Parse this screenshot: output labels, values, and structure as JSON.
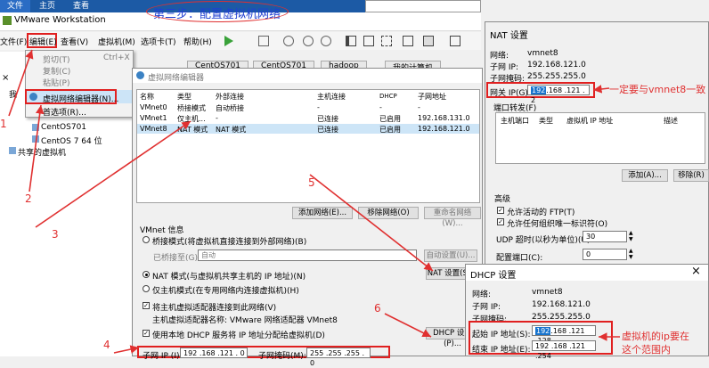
{
  "app": {
    "title": "VMware Workstation",
    "file_tab": "文件",
    "home_tab": "主页",
    "view_tab": "查看"
  },
  "step_title": "第三步：配置虚拟机网络",
  "menubar": {
    "file": "文件(F)",
    "edit": "编辑(E)",
    "view": "查看(V)",
    "vm": "虚拟机(M)",
    "tabs": "选项卡(T)",
    "help": "帮助(H)"
  },
  "edit_menu": {
    "cut": "剪切(T)",
    "cut_shortcut": "Ctrl+X",
    "copy": "复制(C)",
    "paste": "粘贴(P)",
    "vnet_editor": "虚拟网络编辑器(N)...",
    "prefs": "首选项(R)..."
  },
  "library": {
    "items": [
      "CentOS701",
      "CentOS 7 64 位",
      "共享的虚拟机"
    ],
    "me_label": "我"
  },
  "vm_tabs": [
    "CentOS701",
    "CentOS701",
    "hadoop",
    "我的计算机"
  ],
  "vne": {
    "title": "虚拟网络编辑器",
    "columns": [
      "名称",
      "类型",
      "外部连接",
      "主机连接",
      "DHCP",
      "子网地址"
    ],
    "rows": [
      [
        "VMnet0",
        "桥接模式",
        "自动桥接",
        "-",
        "-",
        "-"
      ],
      [
        "VMnet1",
        "仅主机...",
        "-",
        "已连接",
        "已启用",
        "192.168.131.0"
      ],
      [
        "VMnet8",
        "NAT 模式",
        "NAT 模式",
        "已连接",
        "已启用",
        "192.168.121.0"
      ]
    ],
    "add_net": "添加网络(E)...",
    "remove_net": "移除网络(O)",
    "rename_net": "重命名网络(W)...",
    "vmnet_info": "VMnet 信息",
    "bridge_mode": "桥接模式(将虚拟机直接连接到外部网络)(B)",
    "bridged_to": "已桥接至(G):",
    "bridged_value": "自动",
    "auto_settings": "自动设置(U)...",
    "nat_mode": "NAT 模式(与虚拟机共享主机的 IP 地址)(N)",
    "nat_settings": "NAT 设置(S)...",
    "host_only": "仅主机模式(在专用网络内连接虚拟机)(H)",
    "connect_host": "将主机虚拟适配器连接到此网络(V)",
    "adapter_name": "主机虚拟适配器名称: VMware 网络适配器 VMnet8",
    "use_dhcp": "使用本地 DHCP 服务将 IP 地址分配给虚拟机(D)",
    "dhcp_settings": "DHCP 设置(P)...",
    "subnet_ip_label": "子网 IP (I):",
    "subnet_ip": "192 .168 .121 . 0",
    "subnet_mask_label": "子网掩码(M):",
    "subnet_mask": "255 .255 .255 . 0"
  },
  "nat": {
    "title": "NAT 设置",
    "network_label": "网络:",
    "network": "vmnet8",
    "subnet_ip_label": "子网 IP:",
    "subnet_ip": "192.168.121.0",
    "subnet_mask_label": "子网掩码:",
    "subnet_mask": "255.255.255.0",
    "gateway_label": "网关 IP(G):",
    "gateway_sel": "192",
    "gateway_rest": ".168 .121 . 2",
    "port_forward": "端口转发(F)",
    "pf_columns": [
      "主机端口",
      "类型",
      "虚拟机 IP 地址",
      "描述"
    ],
    "add": "添加(A)...",
    "remove": "移除(R)",
    "advanced": "高级",
    "allow_ftp": "允许活动的 FTP(T)",
    "allow_oui": "允许任何组织唯一标识符(O)",
    "udp_label": "UDP 超时(以秒为单位)(U):",
    "udp_value": "30",
    "config_port_label": "配置端口(C):",
    "config_port_value": "0"
  },
  "dhcp": {
    "title": "DHCP 设置",
    "network_label": "网络:",
    "network": "vmnet8",
    "subnet_ip_label": "子网 IP:",
    "subnet_ip": "192.168.121.0",
    "subnet_mask_label": "子网掩码:",
    "subnet_mask": "255.255.255.0",
    "start_label": "起始 IP 地址(S):",
    "start_sel": "192",
    "start_rest": ".168 .121 .128",
    "end_label": "结束 IP 地址(E):",
    "end_value": "192 .168 .121 .254"
  },
  "annotations": {
    "gateway_note": "一定要与vmnet8一致",
    "range_note_1": "虚拟机的ip要在",
    "range_note_2": "这个范围内",
    "n1": "1",
    "n2": "2",
    "n3": "3",
    "n4": "4",
    "n5": "5",
    "n6": "6"
  }
}
